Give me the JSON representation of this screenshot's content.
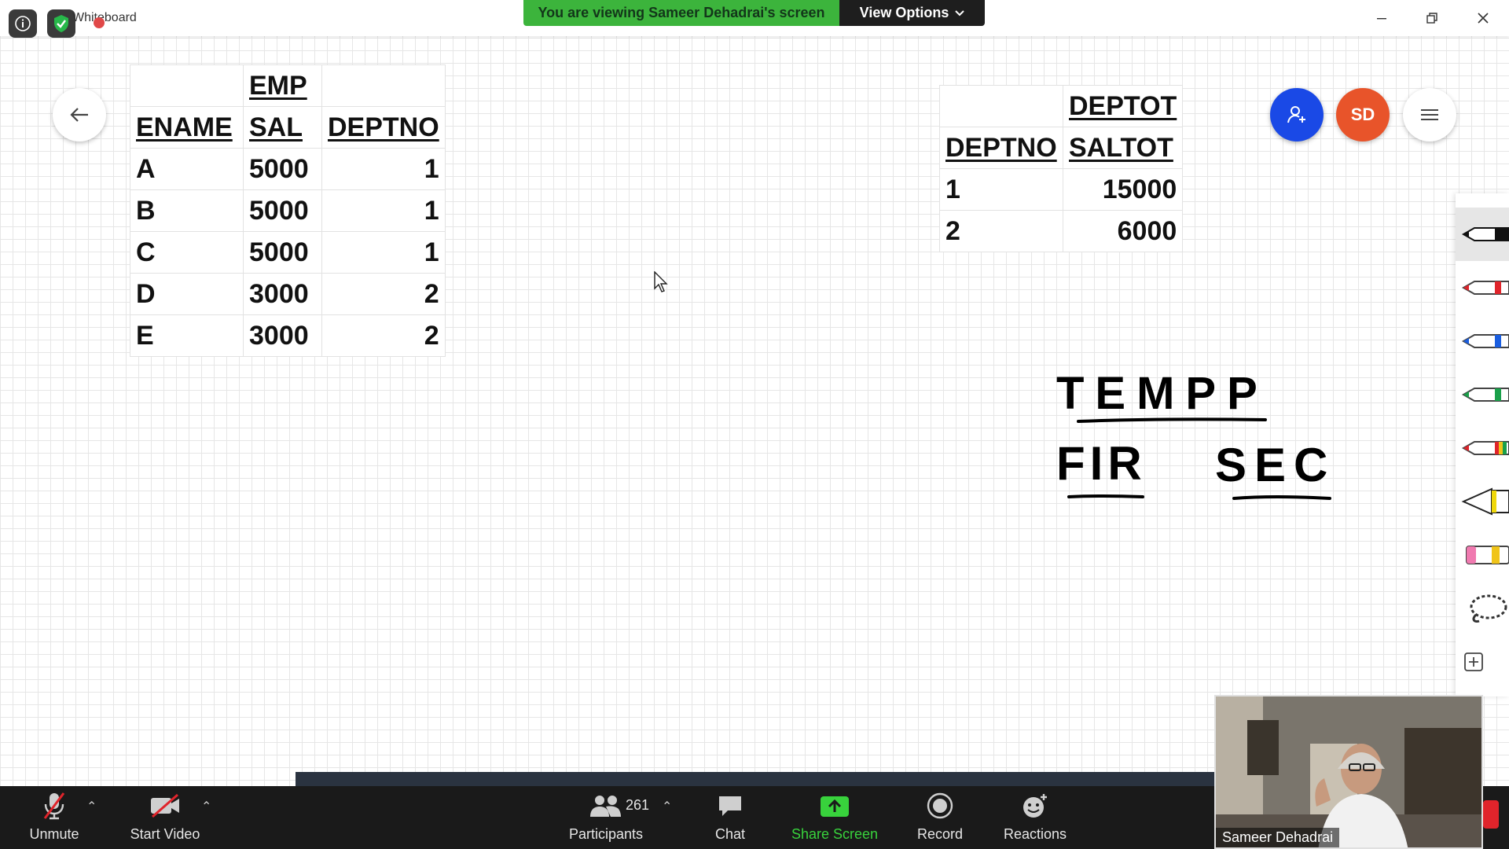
{
  "app": {
    "title": "Whiteboard"
  },
  "banner": {
    "text": "You are viewing Sameer Dehadrai's screen",
    "options_label": "View Options"
  },
  "avatar": {
    "initials": "SD"
  },
  "emp_table": {
    "title": "EMP",
    "columns": [
      "ENAME",
      "SAL",
      "DEPTNO"
    ],
    "rows": [
      [
        "A",
        "5000",
        "1"
      ],
      [
        "B",
        "5000",
        "1"
      ],
      [
        "C",
        "5000",
        "1"
      ],
      [
        "D",
        "3000",
        "2"
      ],
      [
        "E",
        "3000",
        "2"
      ]
    ]
  },
  "dept_table": {
    "title": "DEPTOT",
    "columns": [
      "DEPTNO",
      "SALTOT"
    ],
    "rows": [
      [
        "1",
        "15000"
      ],
      [
        "2",
        "6000"
      ]
    ]
  },
  "handwriting": {
    "line1": "TEMPP",
    "word_left": "FIR",
    "word_right": "SEC"
  },
  "toolbar": {
    "unmute": "Unmute",
    "start_video": "Start Video",
    "participants": "Participants",
    "participant_count": "261",
    "chat": "Chat",
    "share_screen": "Share Screen",
    "record": "Record",
    "reactions": "Reactions"
  },
  "video": {
    "name": "Sameer Dehadrai"
  },
  "colors": {
    "share_green": "#38d23c",
    "banner_green": "#3cb43c",
    "user_button_blue": "#1a49e6",
    "avatar_orange": "#e8542a"
  }
}
